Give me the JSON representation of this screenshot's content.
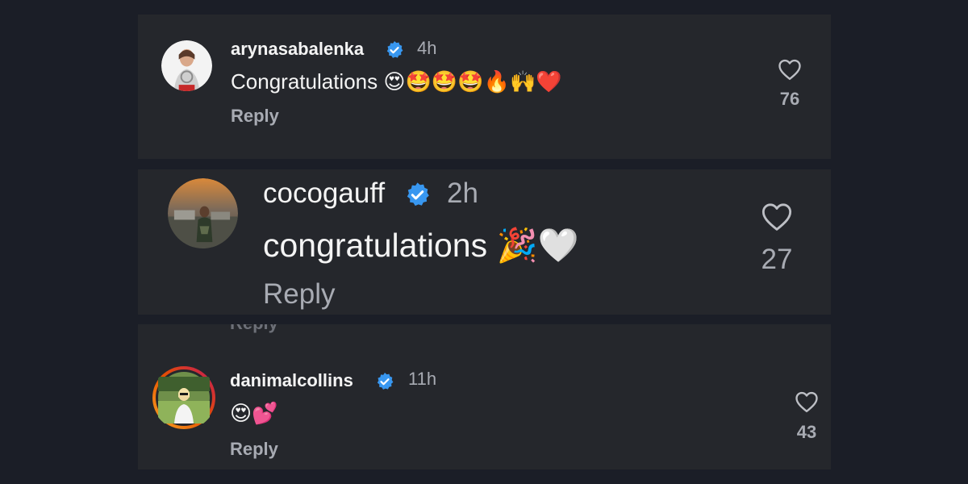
{
  "comments": [
    {
      "username": "arynasabalenka",
      "time": "4h",
      "text": "Congratulations",
      "emojis": "😍🤩🤩🤩🔥🙌❤️",
      "reply_label": "Reply",
      "likes": "76"
    },
    {
      "username": "cocogauff",
      "time": "2h",
      "text": "congratulations",
      "emojis": "🎉🤍",
      "reply_label": "Reply",
      "likes": "27"
    },
    {
      "username": "danimalcollins",
      "time": "11h",
      "text": "",
      "emojis": "😍💕",
      "reply_label": "Reply",
      "likes": "43",
      "partial_reply_above": "Reply"
    }
  ],
  "colors": {
    "background": "#1b1e27",
    "card": "#25272c",
    "verified": "#3897f0",
    "muted_text": "#a8abb3",
    "story_ring_start": "#f9a825",
    "story_ring_end": "#c2185b"
  },
  "icons": {
    "verified": "verified-badge-icon",
    "like": "heart-outline-icon"
  }
}
